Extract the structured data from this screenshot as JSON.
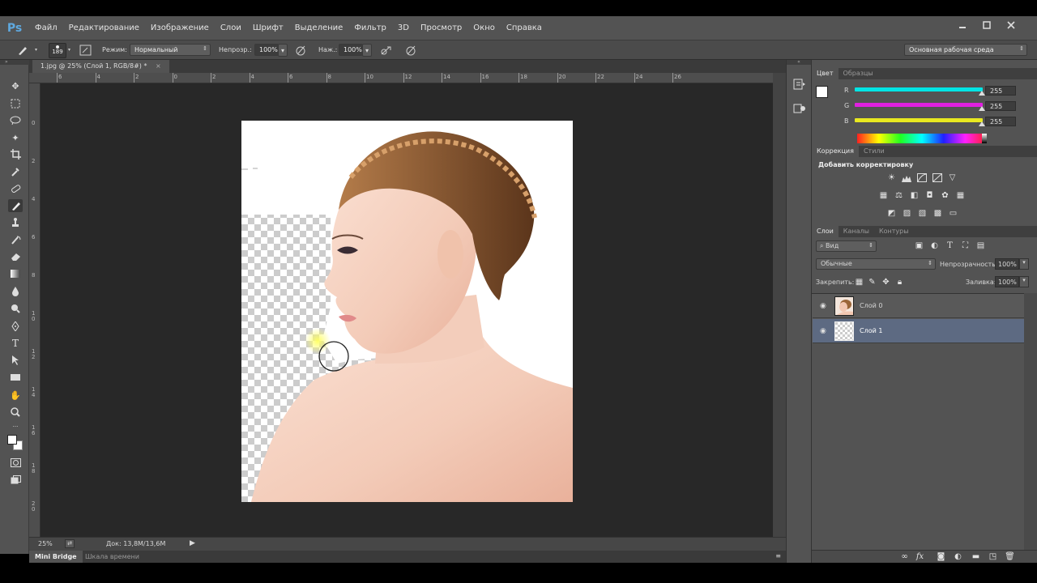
{
  "app": {
    "logo": "Ps"
  },
  "menu": [
    "Файл",
    "Редактирование",
    "Изображение",
    "Слои",
    "Шрифт",
    "Выделение",
    "Фильтр",
    "3D",
    "Просмотр",
    "Окно",
    "Справка"
  ],
  "options": {
    "brush_size": "189",
    "mode_label": "Режим:",
    "mode_value": "Нормальный",
    "opacity_label": "Непрозр.:",
    "opacity_value": "100%",
    "pressure_label": "Наж.:",
    "pressure_value": "100%",
    "workspace": "Основная рабочая среда"
  },
  "document": {
    "tab_title": "1.jpg @ 25% (Слой 1, RGB/8#) *",
    "close_icon": "×",
    "zoom": "25%",
    "doc_size": "Док: 13,8M/13,6M"
  },
  "ruler_top": [
    "6",
    "4",
    "2",
    "0",
    "2",
    "4",
    "6",
    "8",
    "10",
    "12",
    "14",
    "16",
    "18",
    "20",
    "22",
    "24",
    "26"
  ],
  "ruler_left": [
    "0",
    "2",
    "4",
    "6",
    "8",
    "1\n0",
    "1\n2",
    "1\n4",
    "1\n6",
    "1\n8",
    "2\n0"
  ],
  "bottom_tabs": {
    "active": "Mini Bridge",
    "inactive": "Шкала времени"
  },
  "color_panel": {
    "tabs": [
      "Цвет",
      "Образцы"
    ],
    "channels": [
      {
        "label": "R",
        "value": "255",
        "color": "#00e5e5"
      },
      {
        "label": "G",
        "value": "255",
        "color": "#e020e0"
      },
      {
        "label": "B",
        "value": "255",
        "color": "#e8e820"
      }
    ]
  },
  "adjust_panel": {
    "tabs": [
      "Коррекция",
      "Стили"
    ],
    "title": "Добавить корректировку"
  },
  "layers_panel": {
    "tabs": [
      "Слои",
      "Каналы",
      "Контуры"
    ],
    "filter_label": "Вид",
    "blend_mode": "Обычные",
    "opacity_label": "Непрозрачность:",
    "opacity_value": "100%",
    "lock_label": "Закрепить:",
    "fill_label": "Заливка:",
    "fill_value": "100%",
    "layers": [
      {
        "name": "Слой 0",
        "selected": false
      },
      {
        "name": "Слой 1",
        "selected": true
      }
    ]
  }
}
